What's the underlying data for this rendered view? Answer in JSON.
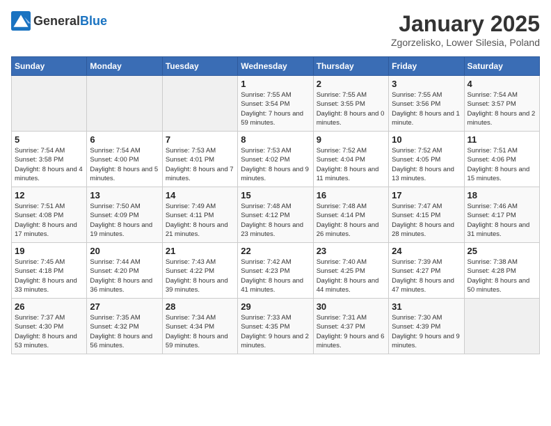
{
  "header": {
    "logo_general": "General",
    "logo_blue": "Blue",
    "title": "January 2025",
    "subtitle": "Zgorzelisko, Lower Silesia, Poland"
  },
  "days_of_week": [
    "Sunday",
    "Monday",
    "Tuesday",
    "Wednesday",
    "Thursday",
    "Friday",
    "Saturday"
  ],
  "weeks": [
    [
      {
        "day": "",
        "info": ""
      },
      {
        "day": "",
        "info": ""
      },
      {
        "day": "",
        "info": ""
      },
      {
        "day": "1",
        "info": "Sunrise: 7:55 AM\nSunset: 3:54 PM\nDaylight: 7 hours and 59 minutes."
      },
      {
        "day": "2",
        "info": "Sunrise: 7:55 AM\nSunset: 3:55 PM\nDaylight: 8 hours and 0 minutes."
      },
      {
        "day": "3",
        "info": "Sunrise: 7:55 AM\nSunset: 3:56 PM\nDaylight: 8 hours and 1 minute."
      },
      {
        "day": "4",
        "info": "Sunrise: 7:54 AM\nSunset: 3:57 PM\nDaylight: 8 hours and 2 minutes."
      }
    ],
    [
      {
        "day": "5",
        "info": "Sunrise: 7:54 AM\nSunset: 3:58 PM\nDaylight: 8 hours and 4 minutes."
      },
      {
        "day": "6",
        "info": "Sunrise: 7:54 AM\nSunset: 4:00 PM\nDaylight: 8 hours and 5 minutes."
      },
      {
        "day": "7",
        "info": "Sunrise: 7:53 AM\nSunset: 4:01 PM\nDaylight: 8 hours and 7 minutes."
      },
      {
        "day": "8",
        "info": "Sunrise: 7:53 AM\nSunset: 4:02 PM\nDaylight: 8 hours and 9 minutes."
      },
      {
        "day": "9",
        "info": "Sunrise: 7:52 AM\nSunset: 4:04 PM\nDaylight: 8 hours and 11 minutes."
      },
      {
        "day": "10",
        "info": "Sunrise: 7:52 AM\nSunset: 4:05 PM\nDaylight: 8 hours and 13 minutes."
      },
      {
        "day": "11",
        "info": "Sunrise: 7:51 AM\nSunset: 4:06 PM\nDaylight: 8 hours and 15 minutes."
      }
    ],
    [
      {
        "day": "12",
        "info": "Sunrise: 7:51 AM\nSunset: 4:08 PM\nDaylight: 8 hours and 17 minutes."
      },
      {
        "day": "13",
        "info": "Sunrise: 7:50 AM\nSunset: 4:09 PM\nDaylight: 8 hours and 19 minutes."
      },
      {
        "day": "14",
        "info": "Sunrise: 7:49 AM\nSunset: 4:11 PM\nDaylight: 8 hours and 21 minutes."
      },
      {
        "day": "15",
        "info": "Sunrise: 7:48 AM\nSunset: 4:12 PM\nDaylight: 8 hours and 23 minutes."
      },
      {
        "day": "16",
        "info": "Sunrise: 7:48 AM\nSunset: 4:14 PM\nDaylight: 8 hours and 26 minutes."
      },
      {
        "day": "17",
        "info": "Sunrise: 7:47 AM\nSunset: 4:15 PM\nDaylight: 8 hours and 28 minutes."
      },
      {
        "day": "18",
        "info": "Sunrise: 7:46 AM\nSunset: 4:17 PM\nDaylight: 8 hours and 31 minutes."
      }
    ],
    [
      {
        "day": "19",
        "info": "Sunrise: 7:45 AM\nSunset: 4:18 PM\nDaylight: 8 hours and 33 minutes."
      },
      {
        "day": "20",
        "info": "Sunrise: 7:44 AM\nSunset: 4:20 PM\nDaylight: 8 hours and 36 minutes."
      },
      {
        "day": "21",
        "info": "Sunrise: 7:43 AM\nSunset: 4:22 PM\nDaylight: 8 hours and 39 minutes."
      },
      {
        "day": "22",
        "info": "Sunrise: 7:42 AM\nSunset: 4:23 PM\nDaylight: 8 hours and 41 minutes."
      },
      {
        "day": "23",
        "info": "Sunrise: 7:40 AM\nSunset: 4:25 PM\nDaylight: 8 hours and 44 minutes."
      },
      {
        "day": "24",
        "info": "Sunrise: 7:39 AM\nSunset: 4:27 PM\nDaylight: 8 hours and 47 minutes."
      },
      {
        "day": "25",
        "info": "Sunrise: 7:38 AM\nSunset: 4:28 PM\nDaylight: 8 hours and 50 minutes."
      }
    ],
    [
      {
        "day": "26",
        "info": "Sunrise: 7:37 AM\nSunset: 4:30 PM\nDaylight: 8 hours and 53 minutes."
      },
      {
        "day": "27",
        "info": "Sunrise: 7:35 AM\nSunset: 4:32 PM\nDaylight: 8 hours and 56 minutes."
      },
      {
        "day": "28",
        "info": "Sunrise: 7:34 AM\nSunset: 4:34 PM\nDaylight: 8 hours and 59 minutes."
      },
      {
        "day": "29",
        "info": "Sunrise: 7:33 AM\nSunset: 4:35 PM\nDaylight: 9 hours and 2 minutes."
      },
      {
        "day": "30",
        "info": "Sunrise: 7:31 AM\nSunset: 4:37 PM\nDaylight: 9 hours and 6 minutes."
      },
      {
        "day": "31",
        "info": "Sunrise: 7:30 AM\nSunset: 4:39 PM\nDaylight: 9 hours and 9 minutes."
      },
      {
        "day": "",
        "info": ""
      }
    ]
  ]
}
